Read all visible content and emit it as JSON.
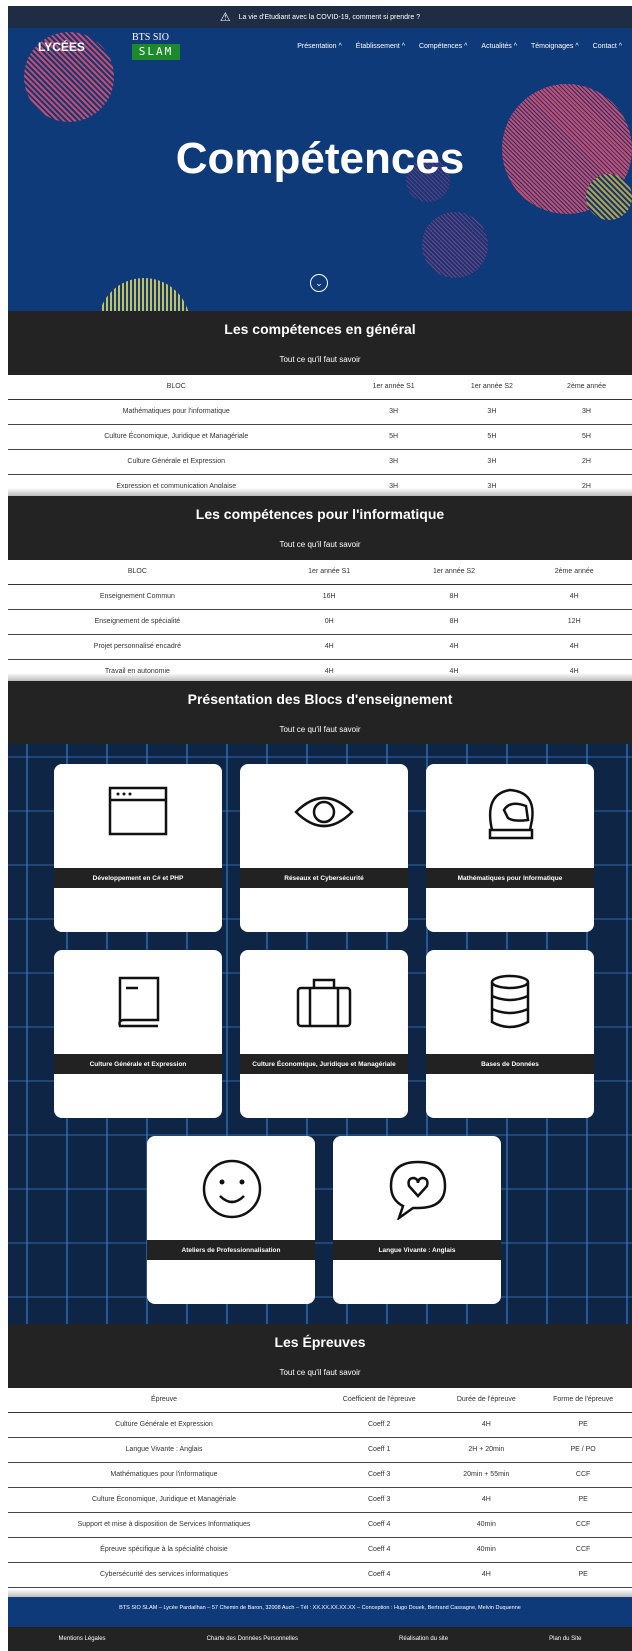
{
  "alert": {
    "text": "La vie d'Etudiant avec la COVID-19, comment si prendre ?"
  },
  "header": {
    "logo_lycees": "LYCÉES",
    "logo_bts": "BTS SIO",
    "logo_slam": "SLAM",
    "nav": [
      "Présentation ^",
      "Établissement ^",
      "Compétences ^",
      "Actualités ^",
      "Témoignages ^",
      "Contact ^"
    ]
  },
  "hero": {
    "title": "Compétences",
    "scroll_icon": "chevron-down-icon"
  },
  "section1": {
    "title": "Les compétences en général",
    "subtitle": "Tout ce qu'il faut savoir",
    "headers": [
      "BLOC",
      "1er année S1",
      "1er année S2",
      "2ème année"
    ],
    "rows": [
      [
        "Mathématiques pour l'informatique",
        "3H",
        "3H",
        "3H"
      ],
      [
        "Culture Économique, Juridique et Managériale",
        "5H",
        "5H",
        "5H"
      ],
      [
        "Culture Générale et Expression",
        "3H",
        "3H",
        "2H"
      ],
      [
        "Expression et communication Anglaise",
        "3H",
        "3H",
        "2H"
      ]
    ]
  },
  "section2": {
    "title": "Les compétences pour l'informatique",
    "subtitle": "Tout ce qu'il faut savoir",
    "headers": [
      "BLOC",
      "1er année S1",
      "1er année S2",
      "2ème année"
    ],
    "rows": [
      [
        "Enseignement Commun",
        "16H",
        "8H",
        "4H"
      ],
      [
        "Enseignement de spécialité",
        "0H",
        "8H",
        "12H"
      ],
      [
        "Projet personnalisé encadré",
        "4H",
        "4H",
        "4H"
      ],
      [
        "Travail en autonomie",
        "4H",
        "4H",
        "4H"
      ]
    ]
  },
  "section3": {
    "title": "Présentation des Blocs d'enseignement",
    "subtitle": "Tout ce qu'il faut savoir",
    "cards": [
      {
        "label": "Développement en C# et PHP",
        "icon": "browser-window-icon"
      },
      {
        "label": "Réseaux et Cybersécurité",
        "icon": "eye-icon"
      },
      {
        "label": "Mathématiques pour Informatique",
        "icon": "helmet-icon"
      },
      {
        "label": "Culture Générale et Expression",
        "icon": "book-icon"
      },
      {
        "label": "Culture Économique, Juridique et Managériale",
        "icon": "briefcase-icon"
      },
      {
        "label": "Bases de Données",
        "icon": "database-icon"
      },
      {
        "label": "Ateliers de Professionnalisation",
        "icon": "smiley-icon"
      },
      {
        "label": "Langue Vivante : Anglais",
        "icon": "chat-heart-icon"
      }
    ]
  },
  "section4": {
    "title": "Les Épreuves",
    "subtitle": "Tout ce qu'il faut savoir",
    "headers": [
      "Épreuve",
      "Coefficient de l'épreuve",
      "Durée de l'épreuve",
      "Forme de l'épreuve"
    ],
    "rows": [
      [
        "Culture Générale et Expression",
        "Coeff 2",
        "4H",
        "PE"
      ],
      [
        "Langue Vivante : Anglais",
        "Coeff 1",
        "2H + 20min",
        "PE / PO"
      ],
      [
        "Mathématiques pour l'informatique",
        "Coeff 3",
        "20min + 55min",
        "CCF"
      ],
      [
        "Culture Économique, Juridique et Managériale",
        "Coeff 3",
        "4H",
        "PE"
      ],
      [
        "Support et mise à disposition de Services Informatiques",
        "Coeff 4",
        "40min",
        "CCF"
      ],
      [
        "Épreuve spécifique à la spécialité choisie",
        "Coeff 4",
        "40min",
        "CCF"
      ],
      [
        "Cybersécurité des services informatiques",
        "Coeff 4",
        "4H",
        "PE"
      ]
    ]
  },
  "footer": {
    "info": "BTS SIO SLAM – Lycée Pardailhan – 57 Chemin de Baron, 32008 Auch – Tél : XX.XX.XX.XX.XX – Conception : Hugo Douek, Bertrand Cassagne, Melvin Duquenne",
    "links": [
      "Mentions Légales",
      "Charte des Données Personnelles",
      "Réalisation du site",
      "Plan du Site"
    ]
  }
}
